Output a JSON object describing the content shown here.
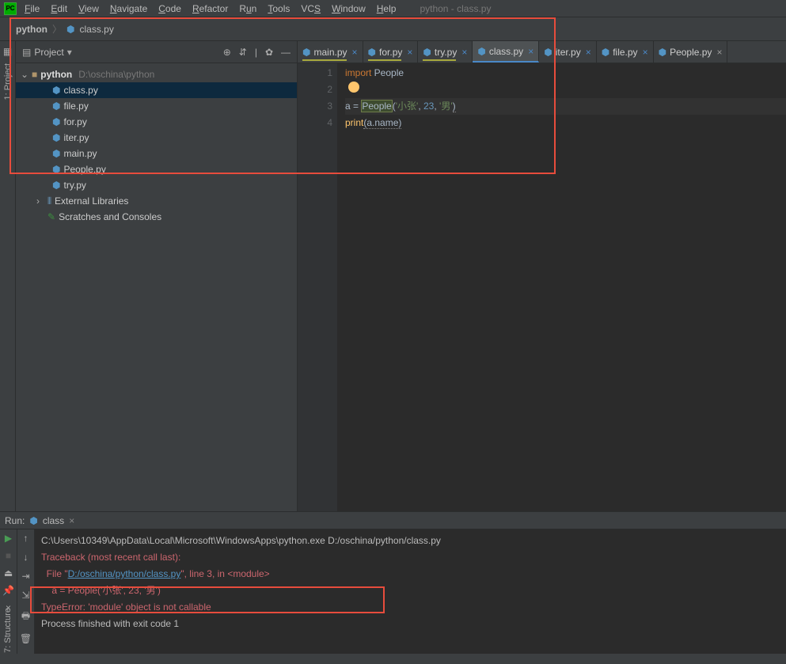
{
  "window": {
    "title": "python - class.py"
  },
  "menu": [
    "File",
    "Edit",
    "View",
    "Navigate",
    "Code",
    "Refactor",
    "Run",
    "Tools",
    "VCS",
    "Window",
    "Help"
  ],
  "breadcrumb": {
    "project": "python",
    "file": "class.py"
  },
  "sidebar": {
    "title": "Project",
    "root": {
      "name": "python",
      "path": "D:\\oschina\\python"
    },
    "files": [
      "class.py",
      "file.py",
      "for.py",
      "iter.py",
      "main.py",
      "People.py",
      "try.py"
    ],
    "external": "External Libraries",
    "scratches": "Scratches and Consoles"
  },
  "tabs": [
    {
      "label": "main.py",
      "modified": true,
      "marked": true
    },
    {
      "label": "for.py",
      "modified": true,
      "marked": true
    },
    {
      "label": "try.py",
      "modified": true,
      "marked": true
    },
    {
      "label": "class.py",
      "modified": true,
      "active": true
    },
    {
      "label": "iter.py",
      "modified": true
    },
    {
      "label": "file.py",
      "modified": true
    },
    {
      "label": "People.py"
    }
  ],
  "code": {
    "lines": [
      "1",
      "2",
      "3",
      "4"
    ],
    "l1_kw": "import",
    "l1_mod": " People",
    "l3_var": "a = ",
    "l3_cls": "People",
    "l3_p1": "(",
    "l3_s1": "'小张'",
    "l3_c1": ", ",
    "l3_n": "23",
    "l3_c2": ", ",
    "l3_s2": "'男'",
    "l3_p2": ")",
    "l4_fn": "print",
    "l4_rest": "(a.name)"
  },
  "run": {
    "label": "Run:",
    "config": "class",
    "out1": "C:\\Users\\10349\\AppData\\Local\\Microsoft\\WindowsApps\\python.exe D:/oschina/python/class.py",
    "out2": "Traceback (most recent call last):",
    "out3a": "  File \"",
    "out3b": "D:/oschina/python/class.py",
    "out3c": "\", line 3, in <module>",
    "out4": "    a = People('小张', 23, '男')",
    "out5": "TypeError: 'module' object is not callable",
    "out6": "",
    "out7": "Process finished with exit code 1"
  },
  "leftbar": {
    "project": "1: Project",
    "structure": "7: Structure"
  }
}
